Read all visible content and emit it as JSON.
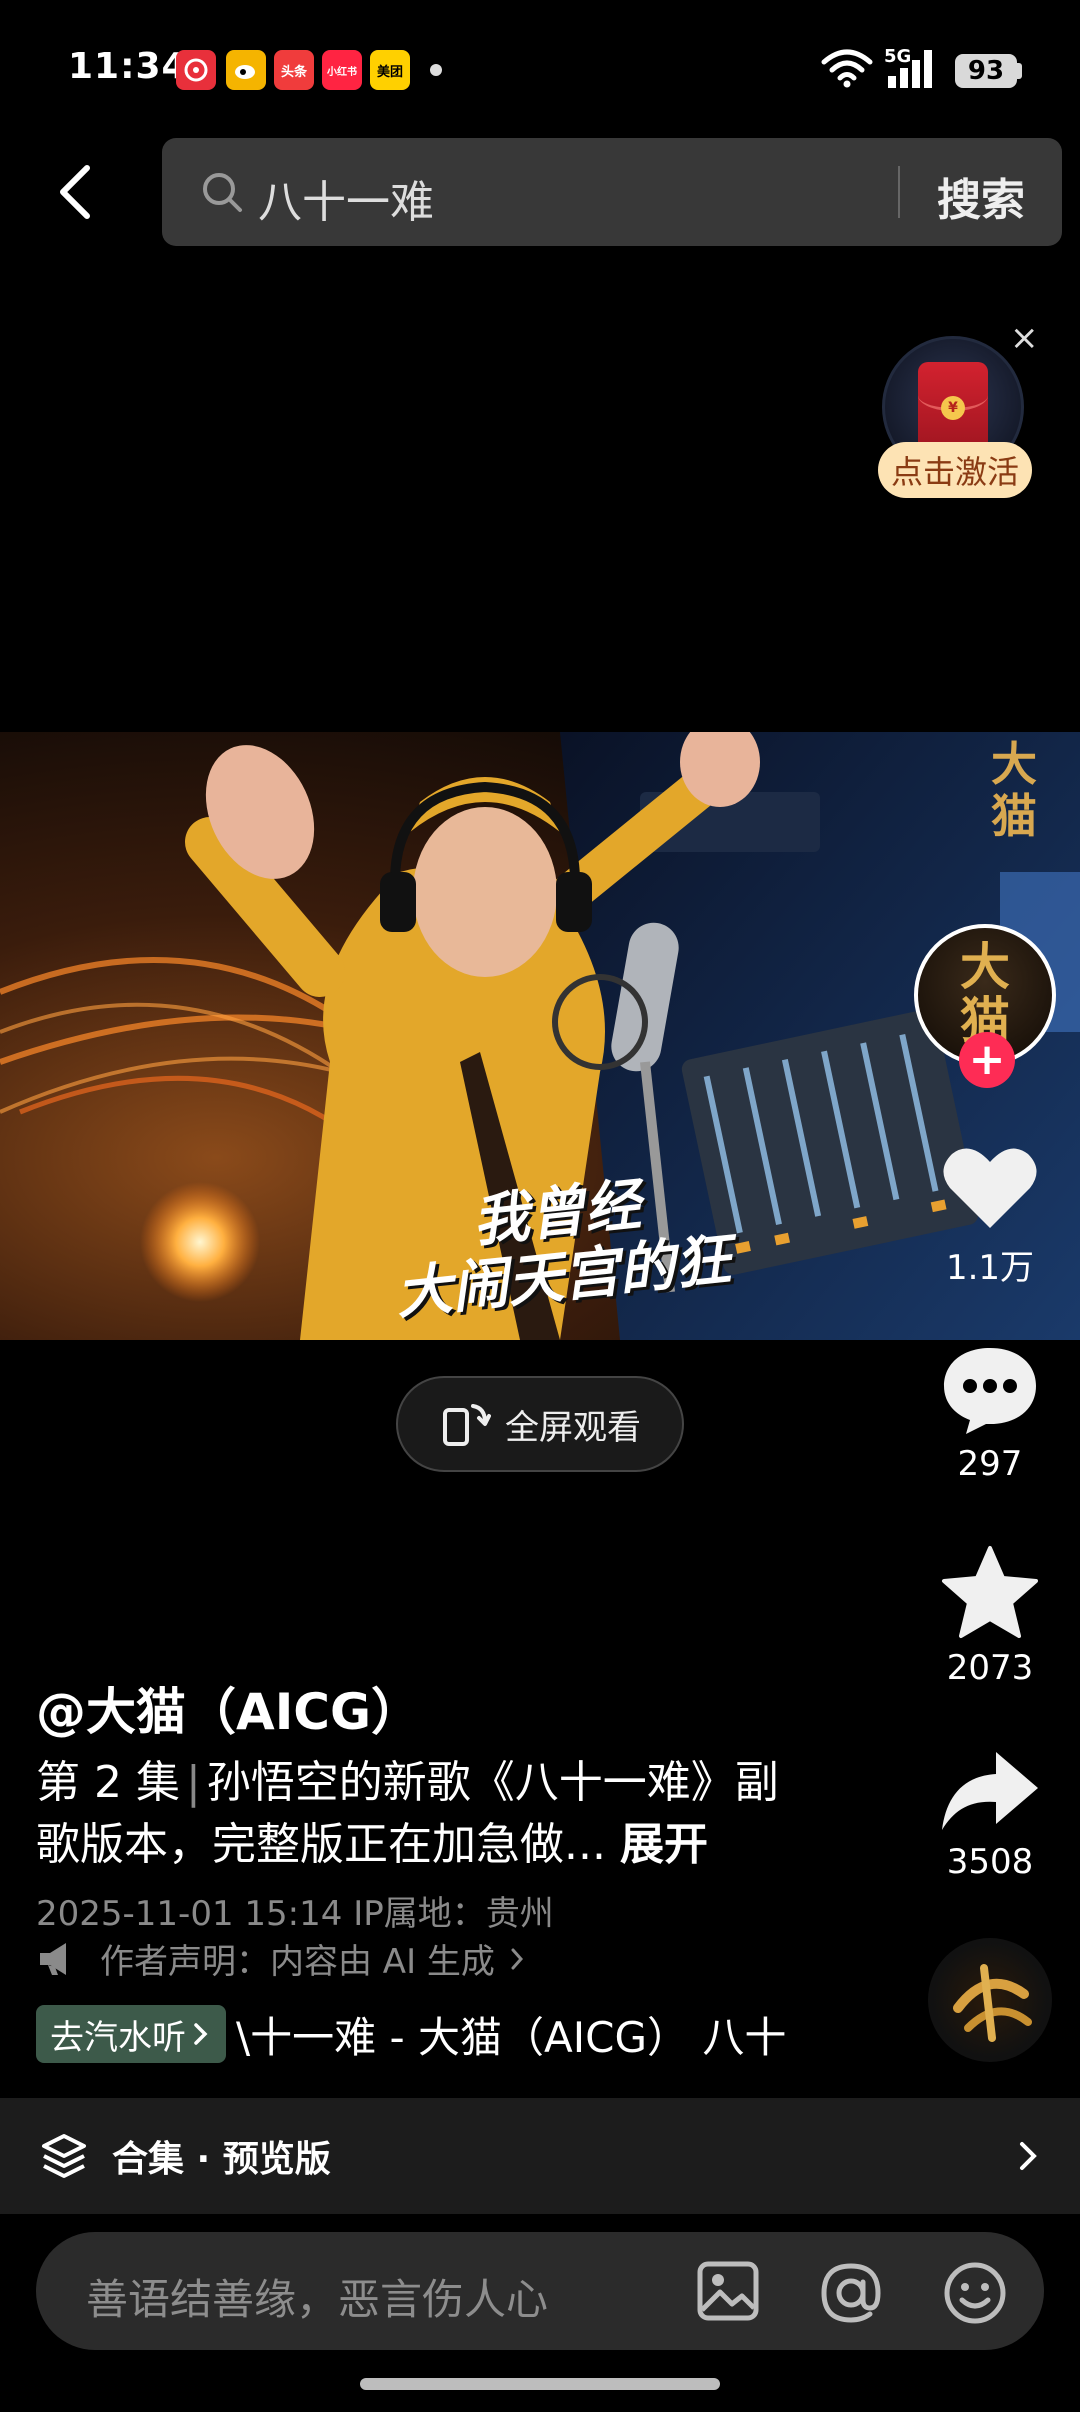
{
  "status_bar": {
    "time": "11:34",
    "notifications": [
      {
        "label": "",
        "color": "#e8303b"
      },
      {
        "label": "",
        "color": "#f5b400"
      },
      {
        "label": "头条",
        "color": "#f03c3c"
      },
      {
        "label": "小红书",
        "color": "#ff2442"
      },
      {
        "label": "美团",
        "color": "#ffd000"
      }
    ],
    "network": "5G",
    "battery": "93"
  },
  "header": {
    "search_query": "八十一难",
    "search_button": "搜索"
  },
  "red_packet": {
    "label": "点击激活",
    "close": "×"
  },
  "video": {
    "overlay_line1": "我曾经",
    "overlay_line2": "大闹天宫的狂",
    "fullscreen_label": "全屏观看"
  },
  "side_rail": {
    "brand_text": "大猫",
    "follow_symbol": "+",
    "like_count": "1.1万",
    "comment_count": "297",
    "favorite_count": "2073",
    "share_count": "3508"
  },
  "caption": {
    "author": "@大猫（AICG）",
    "episode": "第 2 集",
    "text": "孙悟空的新歌《八十一难》副歌版本，完整版正在加急做...",
    "expand": "展开",
    "timestamp": "2025-11-01 15:14  IP属地：贵州",
    "declaration": "作者声明：内容由 AI 生成"
  },
  "music": {
    "qishui_button": "去汽水听",
    "title": "\\十一难 - 大猫（AICG）   八十"
  },
  "collection": {
    "label": "合集 · 预览版"
  },
  "comment": {
    "placeholder": "善语结善缘，恶言伤人心"
  },
  "colors": {
    "accent_red": "#fe2c55",
    "background": "#000000",
    "bar": "#1c1c1c"
  }
}
